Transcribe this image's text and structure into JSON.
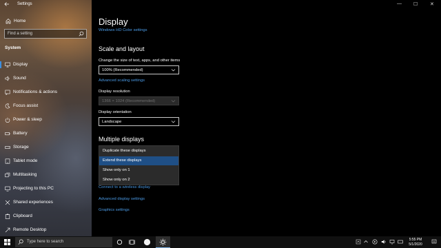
{
  "window": {
    "app_title": "Settings",
    "controls": [
      "—",
      "☐",
      "✕"
    ]
  },
  "sidebar": {
    "home_label": "Home",
    "search_placeholder": "Find a setting",
    "section_label": "System",
    "items": [
      {
        "label": "Display",
        "icon": "monitor-icon",
        "active": true
      },
      {
        "label": "Sound",
        "icon": "speaker-icon"
      },
      {
        "label": "Notifications & actions",
        "icon": "notification-icon"
      },
      {
        "label": "Focus assist",
        "icon": "moon-icon"
      },
      {
        "label": "Power & sleep",
        "icon": "power-icon"
      },
      {
        "label": "Battery",
        "icon": "battery-icon"
      },
      {
        "label": "Storage",
        "icon": "storage-icon"
      },
      {
        "label": "Tablet mode",
        "icon": "tablet-icon"
      },
      {
        "label": "Multitasking",
        "icon": "multitasking-icon"
      },
      {
        "label": "Projecting to this PC",
        "icon": "projecting-icon"
      },
      {
        "label": "Shared experiences",
        "icon": "shared-experiences-icon"
      },
      {
        "label": "Clipboard",
        "icon": "clipboard-icon"
      },
      {
        "label": "Remote Desktop",
        "icon": "remote-desktop-icon"
      }
    ]
  },
  "main": {
    "title": "Display",
    "hd_color_link": "Windows HD Color settings",
    "scale_heading": "Scale and layout",
    "scale_label": "Change the size of text, apps, and other items",
    "scale_value": "100% (Recommended)",
    "advanced_scaling_link": "Advanced scaling settings",
    "resolution_label": "Display resolution",
    "resolution_value": "1366 × 1024 (Recommended)",
    "orientation_label": "Display orientation",
    "orientation_value": "Landscape",
    "multiple_heading": "Multiple displays",
    "multiple_options": [
      {
        "label": "Duplicate these displays",
        "selected": false
      },
      {
        "label": "Extend these displays",
        "selected": true
      },
      {
        "label": "Show only on 1",
        "selected": false
      },
      {
        "label": "Show only on 2",
        "selected": false
      }
    ],
    "wireless_link": "Connect to a wireless display",
    "advanced_display_link": "Advanced display settings",
    "graphics_link": "Graphics settings"
  },
  "taskbar": {
    "search_placeholder": "Type here to search",
    "clock_time": "5:55 PM",
    "clock_date": "5/1/2020"
  },
  "colors": {
    "accent": "#3d8fe0",
    "link": "#4b9be6",
    "selected_option": "#1f4f86"
  }
}
